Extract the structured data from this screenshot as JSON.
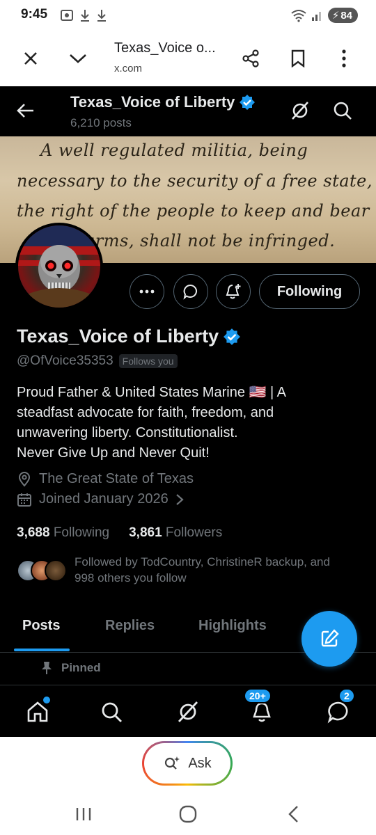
{
  "status_bar": {
    "time": "9:45",
    "battery": "84"
  },
  "browser": {
    "page_title": "Texas_Voice o...",
    "url": "x.com"
  },
  "header": {
    "name": "Texas_Voice of Liberty",
    "posts_count": "6,210 posts"
  },
  "banner": {
    "lines": [
      "A well regulated militia, being",
      "necessary to the security of a free state,",
      "the right of the people to keep and bear",
      "arms, shall not be infringed."
    ]
  },
  "actions": {
    "following_label": "Following"
  },
  "profile": {
    "display_name": "Texas_Voice of Liberty",
    "handle": "@OfVoice35353",
    "follows_you": "Follows you",
    "bio_lines": [
      "Proud Father & United States Marine 🇺🇸 | A",
      "steadfast advocate for faith, freedom, and",
      "unwavering liberty. Constitutionalist.",
      "Never Give Up and Never Quit!"
    ],
    "location": "The Great State of Texas",
    "joined": "Joined January 2026",
    "following_count": "3,688",
    "following_label": "Following",
    "followers_count": "3,861",
    "followers_label": "Followers",
    "followed_by_line1": "Followed by TodCountry, ChristineR backup, and",
    "followed_by_line2": "998 others you follow"
  },
  "tabs": [
    {
      "label": "Posts",
      "active": true
    },
    {
      "label": "Replies",
      "active": false
    },
    {
      "label": "Highlights",
      "active": false
    }
  ],
  "pinned_label": "Pinned",
  "bottom_nav": {
    "notifications_badge": "20+",
    "messages_badge": "2"
  },
  "ask": {
    "label": "Ask"
  },
  "colors": {
    "accent": "#1d9bf0",
    "background": "#000000",
    "text_primary": "#e7e9ea",
    "text_secondary": "#71767b"
  }
}
